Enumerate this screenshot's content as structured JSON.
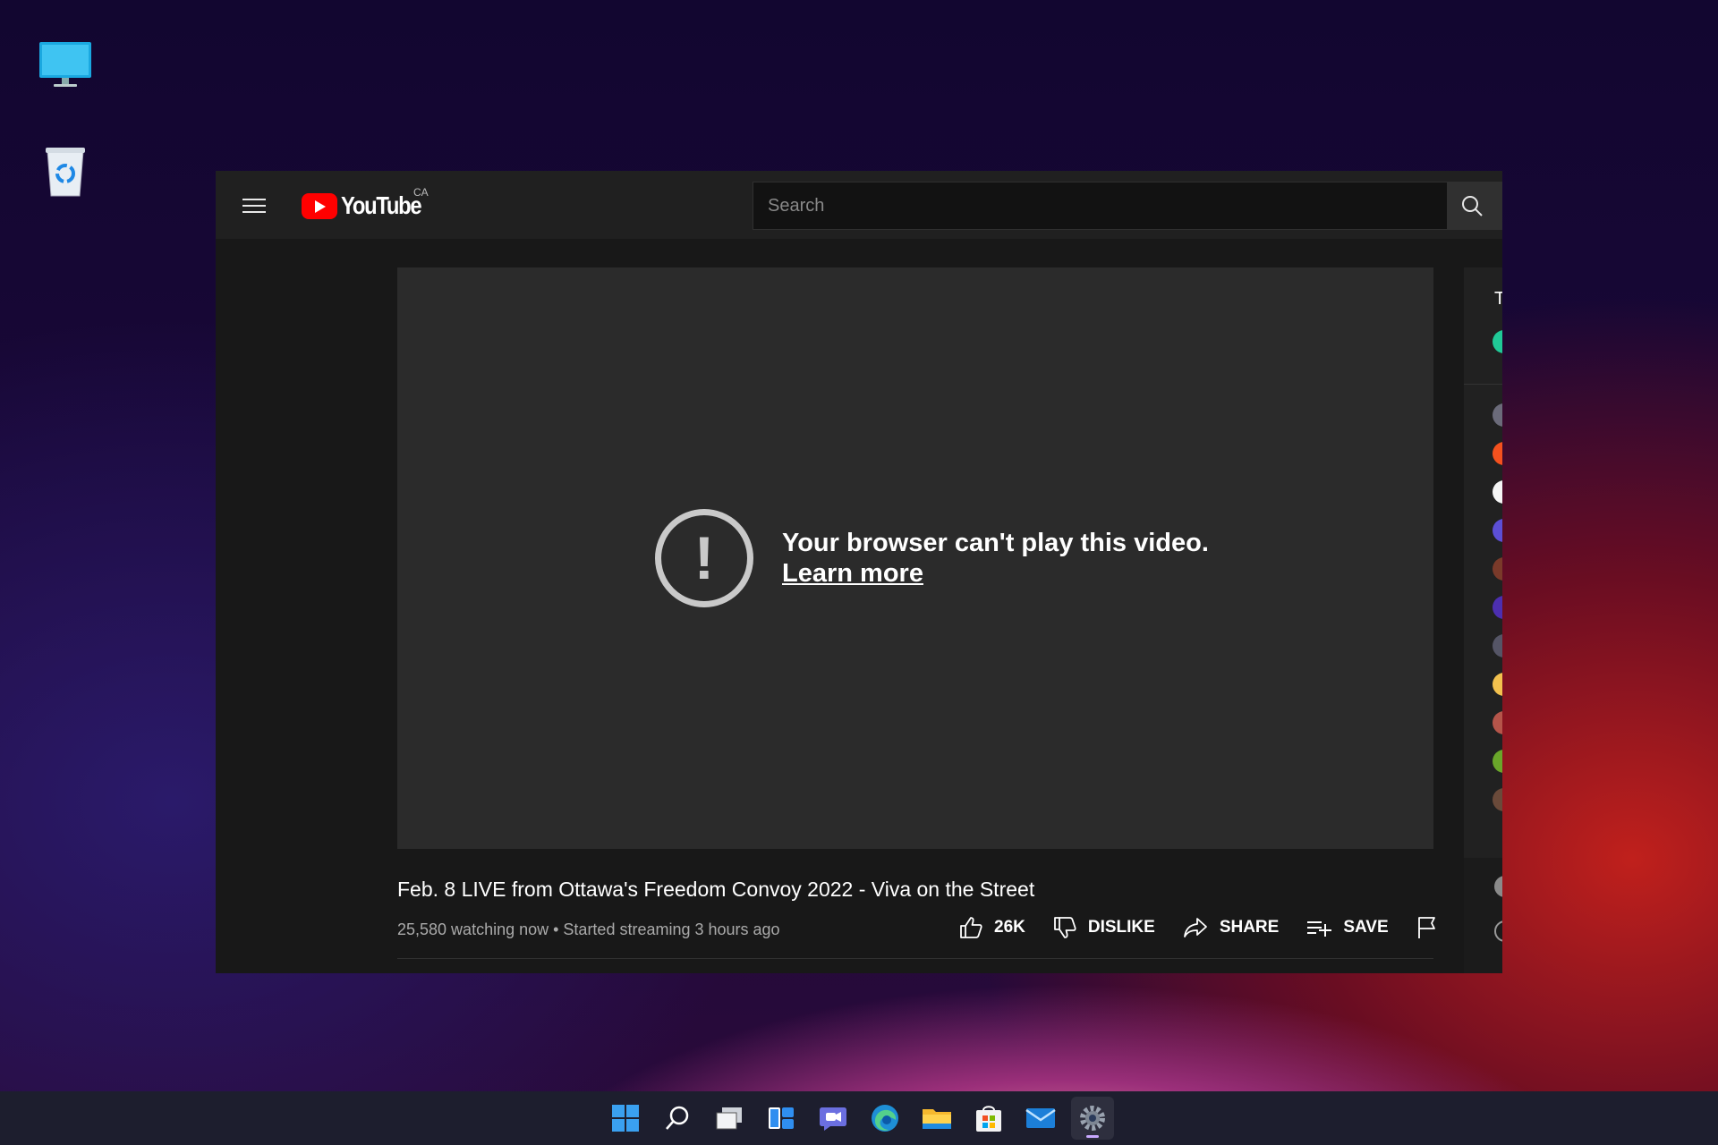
{
  "desktop": {
    "icons": [
      {
        "name": "this-pc"
      },
      {
        "name": "recycle-bin"
      }
    ]
  },
  "youtube": {
    "logo_text": "YouTube",
    "country_code": "CA",
    "search": {
      "placeholder": "Search",
      "value": ""
    },
    "player": {
      "error_message": "Your browser can't play this video.",
      "error_link": "Learn more"
    },
    "video": {
      "title": "Feb. 8 LIVE from Ottawa's Freedom Convoy 2022 - Viva on the Street",
      "meta": "25,580 watching now • Started streaming 3 hours ago",
      "actions": {
        "like_count": "26K",
        "dislike_label": "DISLIKE",
        "share_label": "SHARE",
        "save_label": "SAVE"
      }
    },
    "sidebar": {
      "heading_letter": "T"
    }
  },
  "colors": {
    "youtube_red": "#ff0000",
    "header_bg": "#202020",
    "player_bg": "#2b2b2b",
    "taskbar_bg": "#1d1e2e"
  },
  "taskbar": {
    "items": [
      "start-icon",
      "search-icon",
      "task-view-icon",
      "widgets-icon",
      "chat-icon",
      "edge-icon",
      "file-explorer-icon",
      "store-icon",
      "mail-icon",
      "settings-icon"
    ]
  }
}
